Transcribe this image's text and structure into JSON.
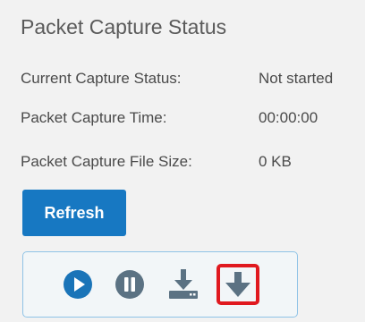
{
  "panel": {
    "title": "Packet Capture Status"
  },
  "status_rows": [
    {
      "label": "Current Capture Status:",
      "value": "Not started"
    },
    {
      "label": "Packet Capture Time:",
      "value": "00:00:00"
    },
    {
      "label": "Packet Capture File Size:",
      "value": "0 KB"
    }
  ],
  "refresh_button": {
    "label": "Refresh"
  },
  "toolbar": {
    "buttons": [
      {
        "icon": "play-circle-icon"
      },
      {
        "icon": "pause-circle-icon"
      },
      {
        "icon": "download-tray-icon"
      },
      {
        "icon": "download-arrow-icon",
        "highlighted": true
      }
    ]
  },
  "colors": {
    "background": "#f2f2f2",
    "primary_button": "#1778c2",
    "play_icon": "#1a74b8",
    "inactive_icon": "#5b7283",
    "toolbar_border": "#8fc3e6",
    "highlight": "#e0191f"
  }
}
